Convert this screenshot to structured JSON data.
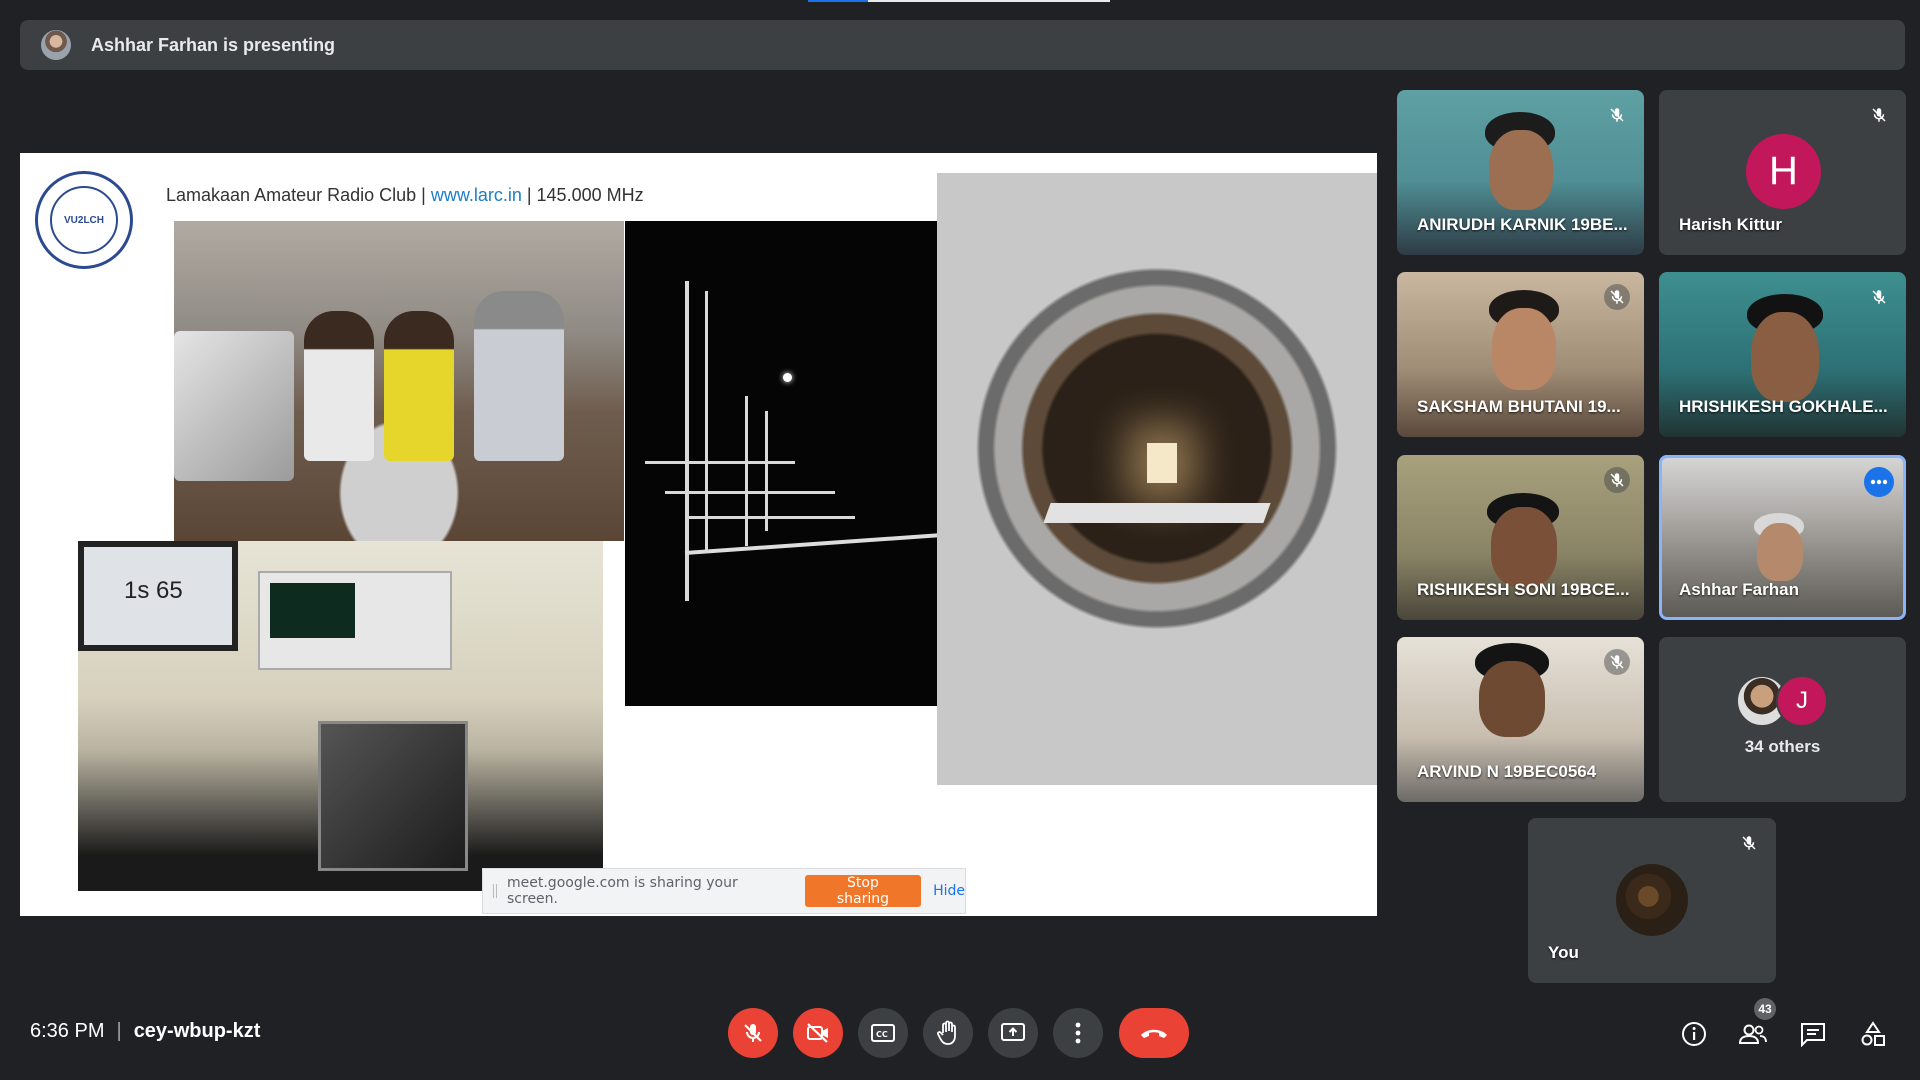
{
  "presenting": {
    "text": "Ashhar Farhan is presenting"
  },
  "slide": {
    "logo_text": "VU2LCH",
    "header_prefix": "Lamakaan Amateur Radio Club | ",
    "header_link": "www.larc.in",
    "header_suffix": " | 145.000 MHz",
    "laptop_text": "1s 65"
  },
  "share_notice": {
    "text": "meet.google.com is sharing your screen.",
    "stop_label": "Stop sharing",
    "hide_label": "Hide"
  },
  "participants": [
    {
      "name": "ANIRUDH KARNIK 19BE...",
      "muted": true
    },
    {
      "name": "Harish Kittur",
      "initial": "H",
      "muted": true
    },
    {
      "name": "SAKSHAM BHUTANI 19...",
      "muted": true
    },
    {
      "name": "HRISHIKESH GOKHALE...",
      "muted": true
    },
    {
      "name": "RISHIKESH SONI 19BCE...",
      "muted": true
    },
    {
      "name": "Ashhar Farhan",
      "muted": false
    },
    {
      "name": "ARVIND N 19BEC0564",
      "muted": true
    }
  ],
  "others": {
    "initial": "J",
    "label": "34 others"
  },
  "self": {
    "name": "You"
  },
  "meeting": {
    "time": "6:36 PM",
    "separator": "|",
    "code": "cey-wbup-kzt"
  },
  "people_count": "43",
  "colors": {
    "accent": "#1a73e8",
    "danger": "#ea4335",
    "avatar_pink": "#c2185b",
    "share_orange": "#f0772a"
  }
}
